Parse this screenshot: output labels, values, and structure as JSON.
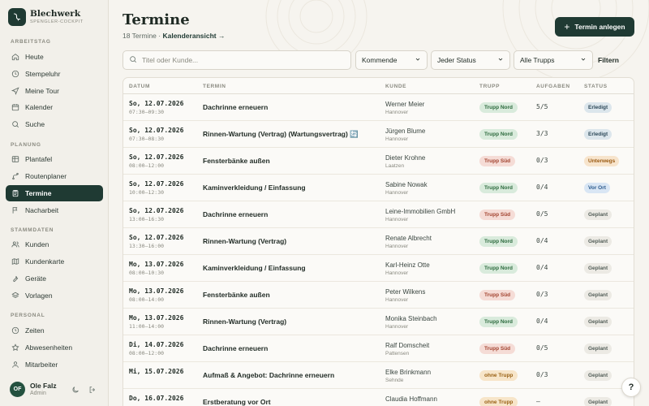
{
  "brand": {
    "name": "Blechwerk",
    "sub": "SPENGLER-COCKPIT"
  },
  "sidebar": {
    "sections": [
      {
        "label": "ARBEITSTAG"
      },
      {
        "label": "PLANUNG"
      },
      {
        "label": "STAMMDATEN"
      },
      {
        "label": "PERSONAL"
      }
    ],
    "items": [
      {
        "label": "Heute",
        "icon": "home-icon"
      },
      {
        "label": "Stempeluhr",
        "icon": "clock-icon"
      },
      {
        "label": "Meine Tour",
        "icon": "navigation-icon"
      },
      {
        "label": "Kalender",
        "icon": "calendar-icon"
      },
      {
        "label": "Suche",
        "icon": "search-icon"
      },
      {
        "label": "Plantafel",
        "icon": "grid-icon"
      },
      {
        "label": "Routenplaner",
        "icon": "route-icon"
      },
      {
        "label": "Termine",
        "icon": "clipboard-icon",
        "active": true
      },
      {
        "label": "Nacharbeit",
        "icon": "flag-icon"
      },
      {
        "label": "Kunden",
        "icon": "users-icon"
      },
      {
        "label": "Kundenkarte",
        "icon": "map-icon"
      },
      {
        "label": "Geräte",
        "icon": "tool-icon"
      },
      {
        "label": "Vorlagen",
        "icon": "layers-icon"
      },
      {
        "label": "Zeiten",
        "icon": "clock-icon"
      },
      {
        "label": "Abwesenheiten",
        "icon": "star-icon"
      },
      {
        "label": "Mitarbeiter",
        "icon": "user-icon"
      }
    ]
  },
  "user": {
    "initials": "OF",
    "name": "Ole Falz",
    "role": "Admin"
  },
  "header": {
    "title": "Termine",
    "count": "18 Termine ·",
    "calendar_link": "Kalenderansicht →",
    "new_button": "Termin anlegen"
  },
  "filters": {
    "search_placeholder": "Titel oder Kunde...",
    "range": "Kommende",
    "status": "Jeder Status",
    "crew": "Alle Trupps",
    "filter_button": "Filtern"
  },
  "table": {
    "columns": [
      "DATUM",
      "TERMIN",
      "KUNDE",
      "TRUPP",
      "AUFGABEN",
      "STATUS"
    ],
    "rows": [
      {
        "date": "So, 12.07.2026",
        "time": "07:30–09:30",
        "title": "Dachrinne erneuern",
        "customer": "Werner Meier",
        "city": "Hannover",
        "crew": "Trupp Nord",
        "tasks": "5/5",
        "status": "Erledigt"
      },
      {
        "date": "So, 12.07.2026",
        "time": "07:30–08:30",
        "title": "Rinnen-Wartung (Vertrag) (Wartungsvertrag) 🔄",
        "customer": "Jürgen Blume",
        "city": "Hannover",
        "crew": "Trupp Nord",
        "tasks": "3/3",
        "status": "Erledigt"
      },
      {
        "date": "So, 12.07.2026",
        "time": "08:00–12:00",
        "title": "Fensterbänke außen",
        "customer": "Dieter Krohne",
        "city": "Laatzen",
        "crew": "Trupp Süd",
        "tasks": "0/3",
        "status": "Unterwegs"
      },
      {
        "date": "So, 12.07.2026",
        "time": "10:00–12:30",
        "title": "Kaminverkleidung / Einfassung",
        "customer": "Sabine Nowak",
        "city": "Hannover",
        "crew": "Trupp Nord",
        "tasks": "0/4",
        "status": "Vor Ort"
      },
      {
        "date": "So, 12.07.2026",
        "time": "13:00–16:30",
        "title": "Dachrinne erneuern",
        "customer": "Leine-Immobilien GmbH",
        "city": "Hannover",
        "crew": "Trupp Süd",
        "tasks": "0/5",
        "status": "Geplant"
      },
      {
        "date": "So, 12.07.2026",
        "time": "13:30–16:00",
        "title": "Rinnen-Wartung (Vertrag)",
        "customer": "Renate Albrecht",
        "city": "Hannover",
        "crew": "Trupp Nord",
        "tasks": "0/4",
        "status": "Geplant"
      },
      {
        "date": "Mo, 13.07.2026",
        "time": "08:00–10:30",
        "title": "Kaminverkleidung / Einfassung",
        "customer": "Karl-Heinz Otte",
        "city": "Hannover",
        "crew": "Trupp Nord",
        "tasks": "0/4",
        "status": "Geplant"
      },
      {
        "date": "Mo, 13.07.2026",
        "time": "08:00–14:00",
        "title": "Fensterbänke außen",
        "customer": "Peter Wilkens",
        "city": "Hannover",
        "crew": "Trupp Süd",
        "tasks": "0/3",
        "status": "Geplant"
      },
      {
        "date": "Mo, 13.07.2026",
        "time": "11:00–14:00",
        "title": "Rinnen-Wartung (Vertrag)",
        "customer": "Monika Steinbach",
        "city": "Hannover",
        "crew": "Trupp Nord",
        "tasks": "0/4",
        "status": "Geplant"
      },
      {
        "date": "Di, 14.07.2026",
        "time": "08:00–12:00",
        "title": "Dachrinne erneuern",
        "customer": "Ralf Domscheit",
        "city": "Pattensen",
        "crew": "Trupp Süd",
        "tasks": "0/5",
        "status": "Geplant"
      },
      {
        "date": "Mi, 15.07.2026",
        "time": "",
        "title": "Aufmaß & Angebot: Dachrinne erneuern",
        "customer": "Elke Brinkmann",
        "city": "Sehnde",
        "crew": "ohne Trupp",
        "tasks": "0/3",
        "status": "Geplant"
      },
      {
        "date": "Do, 16.07.2026",
        "time": "",
        "title": "Erstberatung vor Ort",
        "customer": "Claudia Hoffmann",
        "city": "",
        "crew": "ohne Trupp",
        "tasks": "–",
        "status": "Geplant"
      }
    ]
  },
  "help": {
    "label": "?"
  },
  "colors": {
    "primary": "#1f3a33",
    "crew_nord_bg": "#d9ebdc",
    "crew_nord_fg": "#2c6a3d",
    "crew_sued_bg": "#f5dcd6",
    "crew_sued_fg": "#a2432f",
    "crew_none_bg": "#f7e5c9",
    "crew_none_fg": "#9a6215",
    "st_done_bg": "#dce6ec",
    "st_done_fg": "#2e4a5a",
    "st_way_bg": "#f7e4cc",
    "st_way_fg": "#9a5a12",
    "st_site_bg": "#d9e6f4",
    "st_site_fg": "#2b5a8c",
    "st_plan_bg": "#eceae4",
    "st_plan_fg": "#55605a"
  }
}
